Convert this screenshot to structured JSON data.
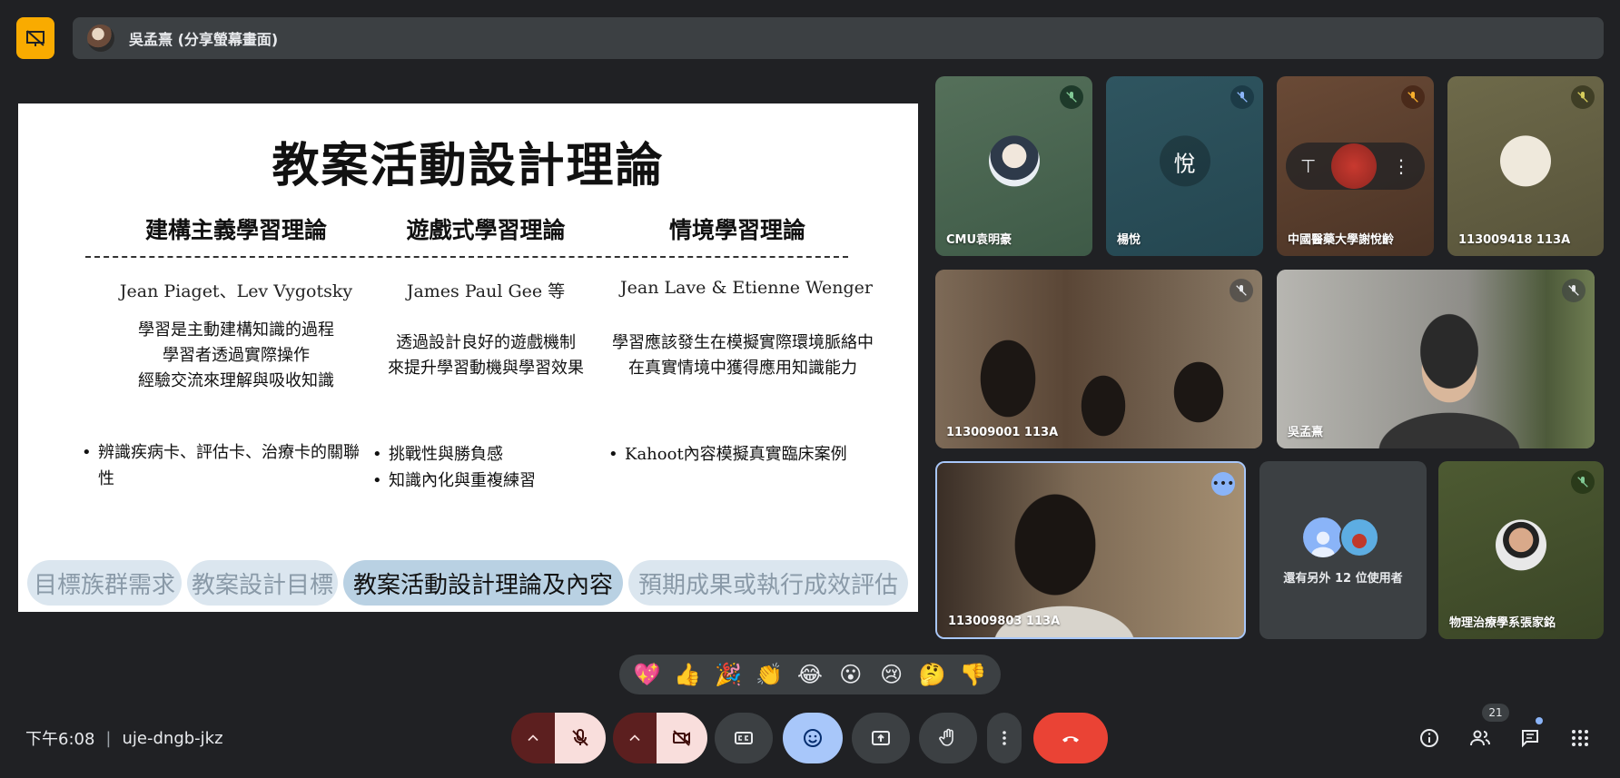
{
  "top": {
    "presenter_label": "吳孟熹 (分享螢幕畫面)"
  },
  "slide": {
    "title": "教案活動設計理論",
    "columns": [
      {
        "heading": "建構主義學習理論",
        "authors": "Jean Piaget、Lev Vygotsky",
        "desc": [
          "學習是主動建構知識的過程",
          "學習者透過實際操作",
          "經驗交流來理解與吸收知識"
        ],
        "bullets": [
          "辨識疾病卡、評估卡、治療卡的關聯性"
        ]
      },
      {
        "heading": "遊戲式學習理論",
        "authors": "James Paul Gee 等",
        "desc": [
          "透過設計良好的遊戲機制",
          "來提升學習動機與學習效果"
        ],
        "bullets": [
          "挑戰性與勝負感",
          "知識內化與重複練習"
        ]
      },
      {
        "heading": "情境學習理論",
        "authors": "Jean Lave & Etienne Wenger",
        "desc": [
          "學習應該發生在模擬實際環境脈絡中",
          "在真實情境中獲得應用知識能力"
        ],
        "bullets": [
          "Kahoot內容模擬真實臨床案例"
        ]
      }
    ],
    "pills": [
      "目標族群需求",
      "教案設計目標",
      "教案活動設計理論及內容",
      "預期成果或執行成效評估"
    ]
  },
  "participants": [
    {
      "name": "CMU袁明豪"
    },
    {
      "name": "楊悅",
      "initial": "悅"
    },
    {
      "name": "中國醫藥大學謝悅齡"
    },
    {
      "name": "113009418 113A"
    },
    {
      "name": "113009001 113A"
    },
    {
      "name": "吳孟熹"
    },
    {
      "name": "113009803 113A"
    },
    {
      "name": "還有另外 12 位使用者"
    },
    {
      "name": "物理治療學系張家銘"
    }
  ],
  "reactions": [
    "💖",
    "👍",
    "🎉",
    "👏",
    "😂",
    "😮",
    "😢",
    "🤔",
    "👎"
  ],
  "bottom": {
    "time": "下午6:08",
    "meeting_code": "uje-dngb-jkz",
    "participant_count": "21"
  },
  "colors": {
    "bg": "#202124",
    "surface": "#3c4043",
    "present_accent": "#f9ab00",
    "end_call": "#ea4335",
    "active_blue": "#8ab4f8",
    "mic_off_red": "#f9dedc"
  },
  "icons": {
    "present": "presentation-off-icon",
    "mic": "mic-off-icon",
    "cam": "videocam-off-icon",
    "captions": "closed-caption-icon",
    "emoji": "emoji-icon",
    "present_now": "present-to-all-icon",
    "hand": "raise-hand-icon",
    "more": "more-vert-icon",
    "end": "call-end-icon",
    "info": "info-icon",
    "people": "people-icon",
    "chat": "chat-icon",
    "apps": "apps-icon"
  }
}
